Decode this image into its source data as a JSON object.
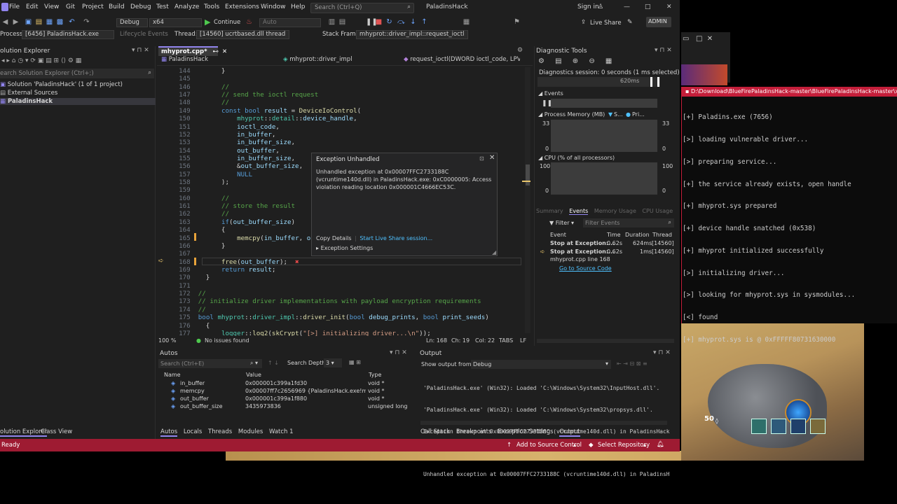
{
  "game": {
    "ammo": "50"
  },
  "console": {
    "title": "D:\\Download\\BlueFirePaladinsHack-master\\BlueFirePaladinsHack-master\\x64\\Del",
    "lines": [
      "[+] Paladins.exe (7656)",
      "[>] loading vulnerable driver...",
      "[>] preparing service...",
      "[+] the service already exists, open handle",
      "[+] mhyprot.sys prepared",
      "[+] device handle snatched (0x538)",
      "[+] mhyprot initialized successfully",
      "[>] initializing driver...",
      "[>] looking for mhyprot.sys in sysmodules...",
      "[<] found",
      "[+] mhyprot.sys is @ 0xFFFFF80731630000"
    ]
  },
  "menubar": {
    "items": [
      "File",
      "Edit",
      "View",
      "Git",
      "Project",
      "Build",
      "Debug",
      "Test",
      "Analyze",
      "Tools",
      "Extensions",
      "Window",
      "Help"
    ],
    "search_placeholder": "Search (Ctrl+Q)",
    "window_title": "PaladinsHack",
    "sign_in": "Sign in",
    "live_share": "Live Share",
    "admin": "ADMIN"
  },
  "toolbar": {
    "config": "Debug",
    "platform": "x64",
    "continue": "Continue",
    "auto": "Auto"
  },
  "toolbar2": {
    "process_label": "Process:",
    "process": "[6456] PaladinsHack.exe",
    "lifecycle": "Lifecycle Events",
    "thread_label": "Thread:",
    "thread": "[14560] ucrtbased.dll thread",
    "stack_label": "Stack Frame:",
    "stack": "mhyprot::driver_impl::request_ioctl"
  },
  "solution_explorer": {
    "title": "olution Explorer",
    "search": "earch Solution Explorer (Ctrl+;)",
    "solution": "Solution 'PaladinsHack' (1 of 1 project)",
    "external": "External Sources",
    "project": "PaladinsHack",
    "tab1": "olution Explorer",
    "tab2": "Class View"
  },
  "editor": {
    "tab": "mhyprot.cpp*",
    "nav_project": "PaladinsHack",
    "nav_scope": "mhyprot::driver_impl",
    "nav_member": "request_ioctl(DWORD ioctl_code, LPVOID",
    "zoom": "100 %",
    "issues": "No issues found",
    "ln": "Ln: 168",
    "ch": "Ch: 19",
    "col": "Col: 22",
    "tabs": "TABS",
    "lf": "LF"
  },
  "exception": {
    "title": "Exception Unhandled",
    "message": "Unhandled exception at 0x00007FFC2733188C (vcruntime140d.dll) in PaladinsHack.exe: 0xC0000005: Access violation reading location 0x000001C4666EC53C.",
    "copy": "Copy Details",
    "live_share": "Start Live Share session...",
    "settings": "Exception Settings"
  },
  "diagnostics": {
    "title": "Diagnostic Tools",
    "session": "Diagnostics session: 0 seconds (1 ms selected)",
    "time_label": "620ms",
    "events": "Events",
    "process_memory": "Process Memory (MB)",
    "mem_legend1": "S...",
    "mem_legend2": "Pri...",
    "mem_max": "33",
    "mem_min": "0",
    "cpu": "CPU (% of all processors)",
    "cpu_max": "100",
    "cpu_min": "0",
    "tabs": [
      "Summary",
      "Events",
      "Memory Usage",
      "CPU Usage"
    ],
    "filter": "Filter",
    "filter_events": "Filter Events",
    "cols": [
      "Event",
      "Time",
      "Duration",
      "Thread"
    ],
    "rows": [
      {
        "event": "Stop at Exception:...",
        "time": "0.62s",
        "duration": "624ms",
        "thread": "[14560]"
      },
      {
        "event": "Stop at Exception:...",
        "time": "0.62s",
        "duration": "1ms",
        "thread": "[14560]",
        "sub": "mhyprot.cpp line 168"
      }
    ],
    "goto": "Go to Source Code"
  },
  "autos": {
    "title": "Autos",
    "search": "Search (Ctrl+E)",
    "depth_label": "Search Depth:",
    "depth": "3",
    "cols": [
      "Name",
      "Value",
      "Type"
    ],
    "rows": [
      {
        "name": "in_buffer",
        "value": "0x000001c399a1fd30",
        "type": "void *"
      },
      {
        "name": "memcpy",
        "value": "0x00007ff7c2656969 {PaladinsHack.exe!memcp...",
        "type": "void *"
      },
      {
        "name": "out_buffer",
        "value": "0x000001c399a1f880",
        "type": "void *"
      },
      {
        "name": "out_buffer_size",
        "value": "3435973836",
        "type": "unsigned long"
      }
    ],
    "tabs": [
      "Autos",
      "Locals",
      "Threads",
      "Modules",
      "Watch 1"
    ]
  },
  "output": {
    "title": "Output",
    "show_label": "Show output from:",
    "source": "Debug",
    "lines": [
      "'PaladinsHack.exe' (Win32): Loaded 'C:\\Windows\\System32\\InputHost.dll'.",
      "'PaladinsHack.exe' (Win32): Loaded 'C:\\Windows\\System32\\propsys.dll'.",
      "Exception thrown at 0x00007FFC2733188C (vcruntime140d.dll) in PaladinsHack.",
      "",
      "Unhandled exception at 0x00007FFC2733188C (vcruntime140d.dll) in PaladinsHa"
    ],
    "tabs": [
      "Call Stack",
      "Breakpoints",
      "Exception Settings",
      "Output"
    ]
  },
  "status": {
    "ready": "Ready",
    "source_control": "Add to Source Control",
    "repository": "Select Repository"
  }
}
